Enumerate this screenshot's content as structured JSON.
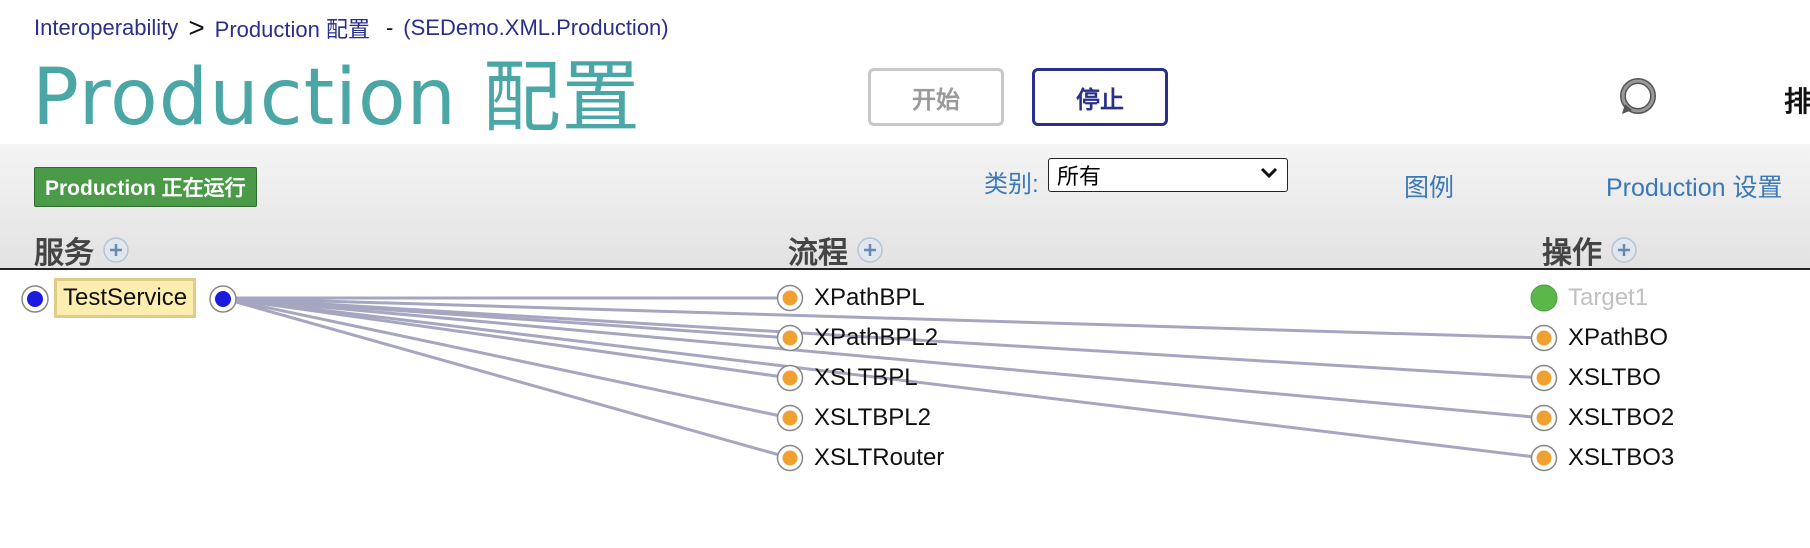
{
  "breadcrumb": {
    "root": "Interoperability",
    "separator": ">",
    "current": "Production 配置",
    "dash": "-",
    "production_name": "(SEDemo.XML.Production)"
  },
  "page_title": "Production 配置",
  "buttons": {
    "start": "开始",
    "stop": "停止"
  },
  "cut_off_text": "排",
  "status_badge": "Production 正在运行",
  "category": {
    "label": "类别:",
    "selected": "所有"
  },
  "links": {
    "legend": "图例",
    "settings": "Production 设置"
  },
  "columns": {
    "services": "服务",
    "processes": "流程",
    "operations": "操作"
  },
  "services": [
    {
      "name": "TestService",
      "status": "selected"
    }
  ],
  "processes": [
    {
      "name": "XPathBPL"
    },
    {
      "name": "XPathBPL2"
    },
    {
      "name": "XSLTBPL"
    },
    {
      "name": "XSLTBPL2"
    },
    {
      "name": "XSLTRouter"
    }
  ],
  "operations": [
    {
      "name": "Target1",
      "status": "disabled"
    },
    {
      "name": "XPathBO"
    },
    {
      "name": "XSLTBO"
    },
    {
      "name": "XSLTBO2"
    },
    {
      "name": "XSLTBO3"
    }
  ],
  "colors": {
    "accent": "#4ba6a6",
    "link": "#3a78b8",
    "nav": "#2a2f8a",
    "running": "#4a9a47",
    "dot_orange": "#f0a030",
    "dot_blue": "#1a1ae0",
    "dot_green": "#5ab84a",
    "connector": "#a6a6c0"
  },
  "icons": {
    "refresh": "refresh-icon",
    "add": "add-icon",
    "chevron": "chevron-down-icon"
  }
}
